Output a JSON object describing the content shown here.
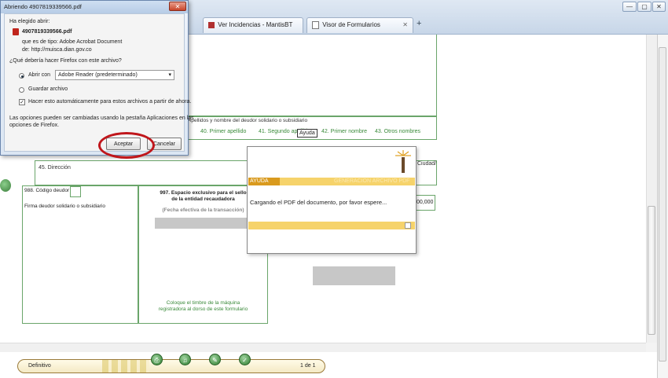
{
  "browser": {
    "tabs": [
      {
        "label": "Ver Incidencias - MantisBT"
      },
      {
        "label": "Visor de Formularios"
      }
    ],
    "new_tab_label": "+",
    "window_controls": [
      "—",
      "▢",
      "✕"
    ]
  },
  "form": {
    "section_header": "Apellidos y nombre del deudor solidario o subsidiario",
    "fields": {
      "primer_apellido": "40. Primer apellido",
      "segundo_apellido": "41. Segundo apellido",
      "primer_nombre": "42. Primer nombre",
      "otros_nombres": "43. Otros nombres",
      "direccion": "45. Dirección",
      "codigo_deudor": "988. Código deudor",
      "firma_deudor": "Firma deudor solidario o subsidiario",
      "ciudad": "Ciudad/"
    },
    "espacio_exclusivo": {
      "line1": "997. Espacio exclusivo para el sello",
      "line2": "de la entidad recaudadora",
      "line3": "(Fecha efectiva de la transacción)"
    },
    "timbre": {
      "line1": "Coloque el timbre de la máquina",
      "line2": "registradora al dorso de este formulario"
    },
    "amount_partial": "00,000"
  },
  "loading_popup": {
    "ayuda_label": "AYUDA",
    "header_title": "GENERACION ARCHIVO PDF",
    "message": "Cargando el PDF del documento, por favor espere..."
  },
  "tooltip": {
    "text": "Ayuda"
  },
  "download_dialog": {
    "title": "Abriendo 4907819339566.pdf",
    "close_label": "✕",
    "intro": "Ha elegido abrir:",
    "filename": "4907819339566.pdf",
    "type_label": "que es de tipo:",
    "type_value": "Adobe Acrobat Document",
    "from_label": "de:",
    "from_value": "http://muisca.dian.gov.co",
    "question": "¿Qué debería hacer Firefox con este archivo?",
    "open_with_label": "Abrir con",
    "open_with_value": "Adobe Reader (predeterminado)",
    "save_label": "Guardar archivo",
    "auto_label": "Hacer esto automáticamente para estos archivos a partir de ahora.",
    "note_line1": "Las opciones pueden ser cambiadas usando la pestaña Aplicaciones en las",
    "note_line2": "opciones de Firefox.",
    "accept_label": "Aceptar",
    "cancel_label": "Cancelar"
  },
  "bottom_toolbar": {
    "status": "Definitivo",
    "page_indicator": "1 de 1"
  },
  "colors": {
    "highlight_ring": "#c0161b",
    "popup_bar": "#f6d36b",
    "form_green": "#3a8a3a"
  }
}
